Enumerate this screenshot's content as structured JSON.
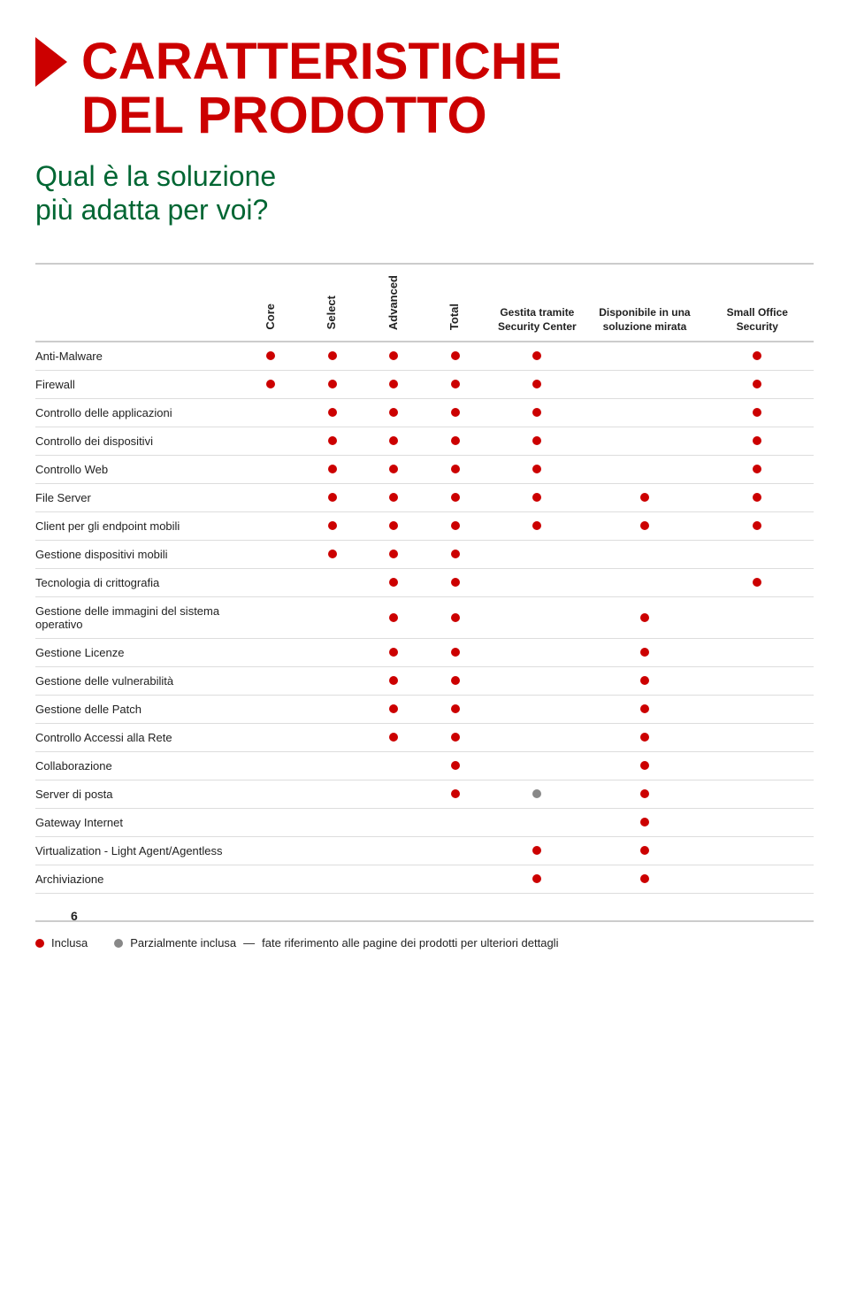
{
  "header": {
    "title_line1": "CARATTERISTICHE",
    "title_line2": "DEL PRODOTTO",
    "subtitle_line1": "Qual è la soluzione",
    "subtitle_line2": "più adatta per voi?"
  },
  "table": {
    "columns": [
      {
        "id": "feature",
        "label": ""
      },
      {
        "id": "core",
        "label": "Core",
        "rotated": true
      },
      {
        "id": "select",
        "label": "Select",
        "rotated": true
      },
      {
        "id": "advanced",
        "label": "Advanced",
        "rotated": true
      },
      {
        "id": "total",
        "label": "Total",
        "rotated": true
      },
      {
        "id": "gestita",
        "label": "Gestita tramite Security Center",
        "rotated": false
      },
      {
        "id": "disponibile",
        "label": "Disponibile in una soluzione mirata",
        "rotated": false
      },
      {
        "id": "small_office",
        "label": "Small Office Security",
        "rotated": false
      }
    ],
    "rows": [
      {
        "feature": "Anti-Malware",
        "core": true,
        "select": true,
        "advanced": true,
        "total": true,
        "gestita": true,
        "disponibile": false,
        "small_office": true
      },
      {
        "feature": "Firewall",
        "core": true,
        "select": true,
        "advanced": true,
        "total": true,
        "gestita": true,
        "disponibile": false,
        "small_office": true
      },
      {
        "feature": "Controllo delle applicazioni",
        "core": false,
        "select": true,
        "advanced": true,
        "total": true,
        "gestita": true,
        "disponibile": false,
        "small_office": true
      },
      {
        "feature": "Controllo dei dispositivi",
        "core": false,
        "select": true,
        "advanced": true,
        "total": true,
        "gestita": true,
        "disponibile": false,
        "small_office": true
      },
      {
        "feature": "Controllo Web",
        "core": false,
        "select": true,
        "advanced": true,
        "total": true,
        "gestita": true,
        "disponibile": false,
        "small_office": true
      },
      {
        "feature": "File Server",
        "core": false,
        "select": true,
        "advanced": true,
        "total": true,
        "gestita": true,
        "disponibile": true,
        "small_office": true
      },
      {
        "feature": "Client per gli endpoint mobili",
        "core": false,
        "select": true,
        "advanced": true,
        "total": true,
        "gestita": true,
        "disponibile": true,
        "small_office": true
      },
      {
        "feature": "Gestione dispositivi mobili",
        "core": false,
        "select": true,
        "advanced": true,
        "total": true,
        "gestita": false,
        "disponibile": false,
        "small_office": false
      },
      {
        "feature": "Tecnologia di crittografia",
        "core": false,
        "select": false,
        "advanced": true,
        "total": true,
        "gestita": false,
        "disponibile": false,
        "small_office": true
      },
      {
        "feature": "Gestione delle immagini del sistema operativo",
        "core": false,
        "select": false,
        "advanced": true,
        "total": true,
        "gestita": false,
        "disponibile": true,
        "small_office": false
      },
      {
        "feature": "Gestione Licenze",
        "core": false,
        "select": false,
        "advanced": true,
        "total": true,
        "gestita": false,
        "disponibile": true,
        "small_office": false
      },
      {
        "feature": "Gestione delle vulnerabilità",
        "core": false,
        "select": false,
        "advanced": true,
        "total": true,
        "gestita": false,
        "disponibile": true,
        "small_office": false
      },
      {
        "feature": "Gestione delle Patch",
        "core": false,
        "select": false,
        "advanced": true,
        "total": true,
        "gestita": false,
        "disponibile": true,
        "small_office": false
      },
      {
        "feature": "Controllo Accessi alla Rete",
        "core": false,
        "select": false,
        "advanced": true,
        "total": true,
        "gestita": false,
        "disponibile": true,
        "small_office": false
      },
      {
        "feature": "Collaborazione",
        "core": false,
        "select": false,
        "advanced": false,
        "total": true,
        "gestita": false,
        "disponibile": true,
        "small_office": false
      },
      {
        "feature": "Server di posta",
        "core": false,
        "select": false,
        "advanced": false,
        "total": true,
        "gestita": "partial",
        "disponibile": true,
        "small_office": false
      },
      {
        "feature": "Gateway Internet",
        "core": false,
        "select": false,
        "advanced": false,
        "total": false,
        "gestita": false,
        "disponibile": true,
        "small_office": false
      },
      {
        "feature": "Virtualization - Light Agent/Agentless",
        "core": false,
        "select": false,
        "advanced": false,
        "total": false,
        "gestita": true,
        "disponibile": true,
        "small_office": false
      },
      {
        "feature": "Archiviazione",
        "core": false,
        "select": false,
        "advanced": false,
        "total": false,
        "gestita": true,
        "disponibile": true,
        "small_office": false
      }
    ]
  },
  "legend": {
    "included_label": "Inclusa",
    "partial_label": "Parzialmente inclusa",
    "note": "fate riferimento alle pagine dei prodotti per ulteriori dettagli"
  },
  "page_number": "6"
}
